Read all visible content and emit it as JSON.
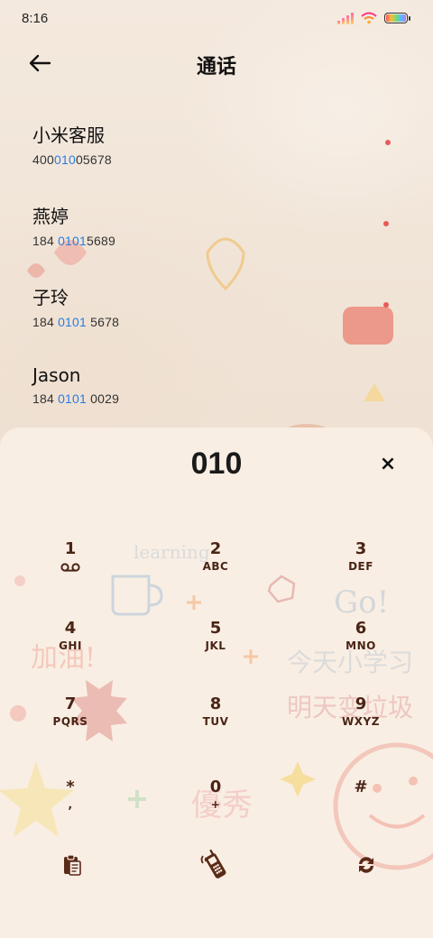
{
  "status_bar": {
    "time": "8:16"
  },
  "header": {
    "title": "通话"
  },
  "contacts": [
    {
      "name": "小米客服",
      "number_pre": "400",
      "number_hl": "010",
      "number_post": "05678"
    },
    {
      "name": "燕婷",
      "number_pre": "184 ",
      "number_hl": "0101",
      "number_post": "5689"
    },
    {
      "name": "子玲",
      "number_pre": "184 ",
      "number_hl": "0101",
      "number_post": " 5678"
    },
    {
      "name": "Jason",
      "number_pre": "184 ",
      "number_hl": "0101",
      "number_post": " 0029"
    }
  ],
  "dialpad": {
    "input_value": "010",
    "clear_label": "×",
    "keys": [
      {
        "digit": "1",
        "letters": ""
      },
      {
        "digit": "2",
        "letters": "ABC"
      },
      {
        "digit": "3",
        "letters": "DEF"
      },
      {
        "digit": "4",
        "letters": "GHI"
      },
      {
        "digit": "5",
        "letters": "JKL"
      },
      {
        "digit": "6",
        "letters": "MNO"
      },
      {
        "digit": "7",
        "letters": "PQRS"
      },
      {
        "digit": "8",
        "letters": "TUV"
      },
      {
        "digit": "9",
        "letters": "WXYZ"
      },
      {
        "digit": "*",
        "letters": ","
      },
      {
        "digit": "0",
        "letters": "+"
      },
      {
        "digit": "#",
        "letters": ""
      }
    ],
    "actions": [
      "clipboard-icon",
      "call-icon",
      "switch-icon"
    ]
  },
  "colors": {
    "accent": "#2a7de1",
    "key_text": "#4a2416"
  }
}
